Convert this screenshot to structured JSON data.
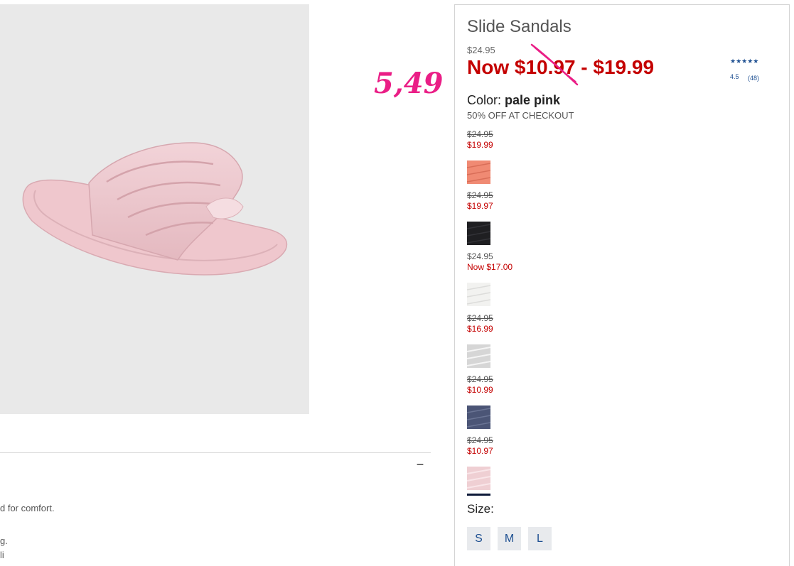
{
  "product": {
    "title": "Slide Sandals",
    "original_price": "$24.95",
    "now_price_range": "Now $10.97 - $19.99",
    "color_label": "Color:",
    "color_value": "pale pink",
    "promo": "50% OFF AT CHECKOUT"
  },
  "annotation": {
    "text": "5,49",
    "color": "#ea1e86"
  },
  "rating": {
    "stars_text": "★★★★★",
    "value": "4.5",
    "count": "(48)",
    "score": 4.5
  },
  "variants": [
    {
      "old": "$24.95",
      "new": "$19.99",
      "old_struck": true,
      "swatch_color": "#f08a73",
      "name": "coral"
    },
    {
      "old": "$24.95",
      "new": "$19.97",
      "old_struck": true,
      "swatch_color": "#1f1f22",
      "name": "black"
    },
    {
      "old": "$24.95",
      "new": "Now $17.00",
      "old_struck": false,
      "swatch_color": "#f2f2f0",
      "name": "white"
    },
    {
      "old": "$24.95",
      "new": "$16.99",
      "old_struck": true,
      "swatch_color": "#d6d6d6",
      "name": "silver"
    },
    {
      "old": "$24.95",
      "new": "$10.99",
      "old_struck": true,
      "swatch_color": "#4b5576",
      "name": "navy"
    },
    {
      "old": "$24.95",
      "new": "$10.97",
      "old_struck": true,
      "swatch_color": "#efcfd3",
      "name": "pale-pink",
      "selected": true
    }
  ],
  "size": {
    "label": "Size:",
    "options": [
      "S",
      "M",
      "L"
    ]
  },
  "description": {
    "toggle": "−",
    "lines": [
      "d for comfort.",
      "g.",
      "li"
    ]
  },
  "colors": {
    "sale_red": "#c40000",
    "link_blue": "#1d4f91"
  }
}
